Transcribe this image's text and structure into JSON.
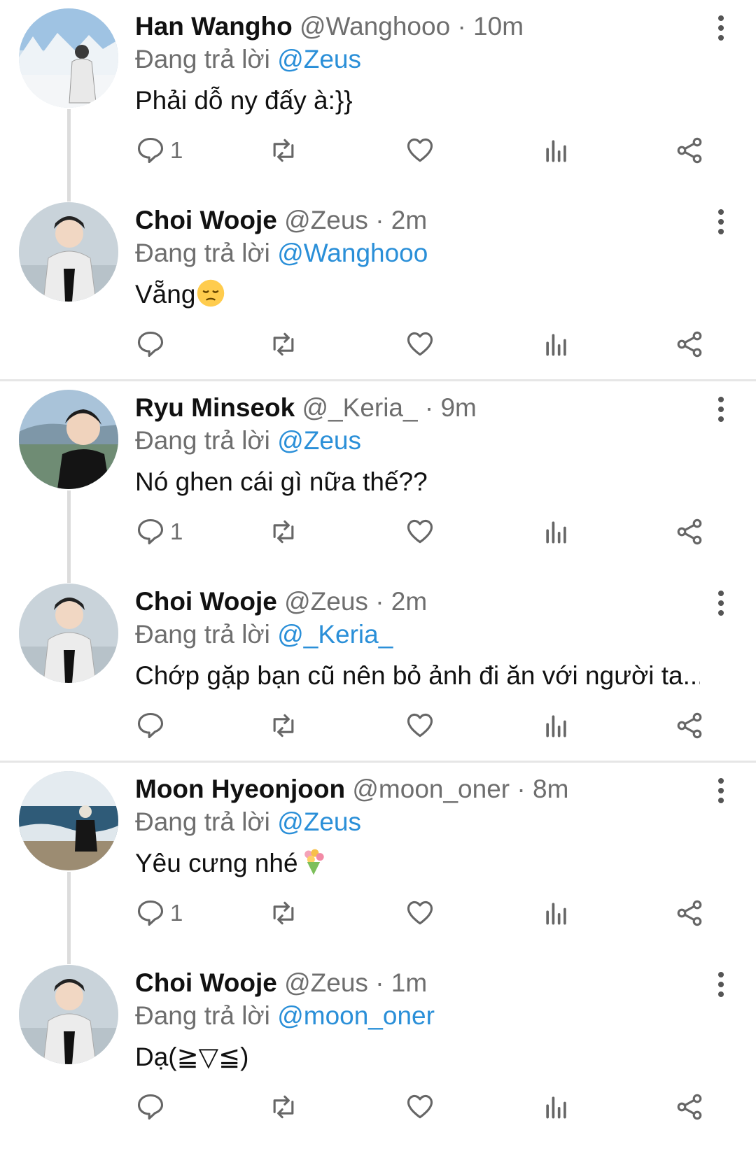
{
  "colors": {
    "mention": "#2a8fd8",
    "muted": "#6e6e6e",
    "separator": "#e6e6e6"
  },
  "threads": [
    {
      "tweets": [
        {
          "name": "Han Wangho",
          "handle": "@Wanghooo",
          "time": "· 10m",
          "reply_prefix": "Đang trả lời",
          "reply_to": "@Zeus",
          "text": "Phải dỗ ny đấy à:}}",
          "emoji": "",
          "reply_count": "1",
          "avatar": "snow-scene"
        },
        {
          "name": "Choi Wooje",
          "handle": "@Zeus",
          "time": "· 2m",
          "reply_prefix": "Đang trả lời",
          "reply_to": "@Wanghooo",
          "text": "Vẵng",
          "emoji": "pensive-face",
          "reply_count": "",
          "avatar": "white-jacket"
        }
      ]
    },
    {
      "tweets": [
        {
          "name": "Ryu Minseok",
          "handle": "@_Keria_",
          "time": "· 9m",
          "reply_prefix": "Đang trả lời",
          "reply_to": "@Zeus",
          "text": "Nó ghen cái gì nữa thế??",
          "emoji": "",
          "reply_count": "1",
          "avatar": "city-view"
        },
        {
          "name": "Choi Wooje",
          "handle": "@Zeus",
          "time": "· 2m",
          "reply_prefix": "Đang trả lời",
          "reply_to": "@_Keria_",
          "text": "Chớp gặp bạn cũ nên bỏ ảnh đi ăn với người ta...",
          "emoji": "",
          "reply_count": "",
          "avatar": "white-jacket"
        }
      ]
    },
    {
      "tweets": [
        {
          "name": "Moon Hyeonjoon",
          "handle": "@moon_oner",
          "time": "· 8m",
          "reply_prefix": "Đang trả lời",
          "reply_to": "@Zeus",
          "text": "Yêu cưng nhé",
          "emoji": "bouquet",
          "reply_count": "1",
          "avatar": "beach"
        },
        {
          "name": "Choi Wooje",
          "handle": "@Zeus",
          "time": "· 1m",
          "reply_prefix": "Đang trả lời",
          "reply_to": "@moon_oner",
          "text": "Dạ(≧▽≦)",
          "emoji": "",
          "reply_count": "",
          "avatar": "white-jacket"
        }
      ]
    }
  ]
}
